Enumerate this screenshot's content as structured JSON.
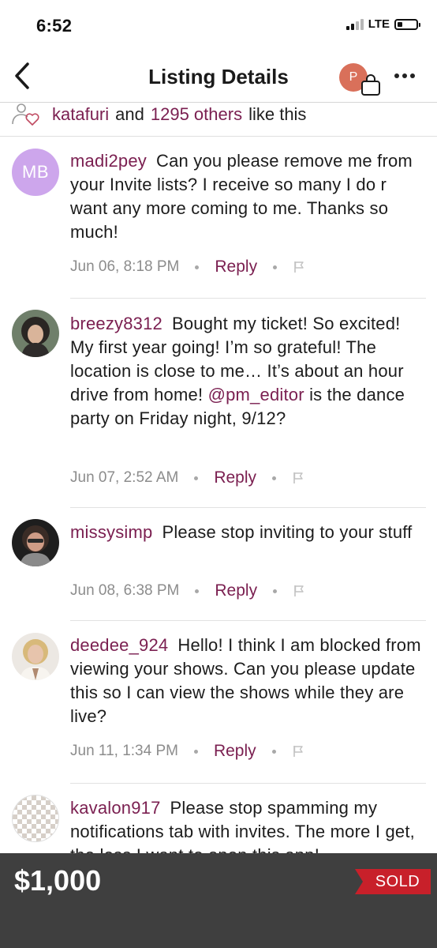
{
  "status_bar": {
    "time": "6:52",
    "network": "LTE"
  },
  "nav": {
    "title": "Listing Details",
    "avatar_initial": "P",
    "icons": [
      "back-chevron-icon",
      "shopping-bag-icon",
      "more-dots-icon"
    ]
  },
  "likes": {
    "first_user": "katafuri",
    "and": "and",
    "others": "1295 others",
    "suffix": "like this",
    "icon": "likes-people-heart-icon"
  },
  "comments": [
    {
      "avatar_initials": "MB",
      "avatar_color": "#cda6ec",
      "username": "madi2pey",
      "text": "Can you please remove me from your Invite lists?  I receive so many I do r want any more coming to me. Thanks so much!",
      "date": "Jun 06, 8:18 PM",
      "reply": "Reply"
    },
    {
      "username": "breezy8312",
      "text_before": "Bought my ticket! So excited! My first year going! I’m so grateful! The location is close to me… It’s about an hour drive from home!",
      "mention": "@pm_editor",
      "text_after": "is the dance party on Friday night, 9/12?",
      "date": "Jun 07, 2:52 AM",
      "reply": "Reply"
    },
    {
      "username": "missysimp",
      "text": "Please stop inviting to your stuff",
      "date": "Jun 08, 6:38 PM",
      "reply": "Reply"
    },
    {
      "username": "deedee_924",
      "text": "Hello! I think I am blocked from viewing your shows. Can you please update this so I can view the shows while they are live?",
      "date": "Jun 11, 1:34 PM",
      "reply": "Reply"
    },
    {
      "username": "kavalon917",
      "text": "Please stop spamming my notifications tab with invites. The more I get, the less I want to open this app!"
    }
  ],
  "footer": {
    "price": "$1,000",
    "status": "SOLD",
    "badge_color": "#c8202a"
  },
  "colors": {
    "accent": "#7b2051",
    "footer_bg": "#3f3f3f"
  }
}
